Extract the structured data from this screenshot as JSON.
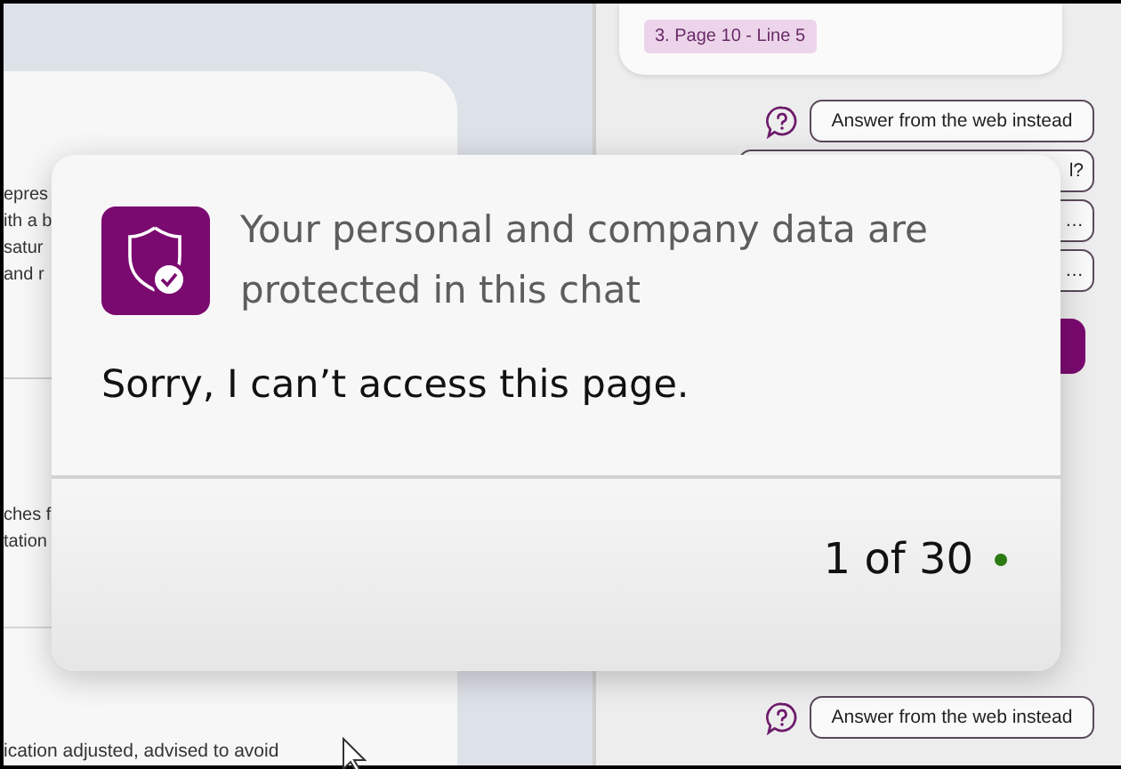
{
  "document": {
    "fragments_top": [
      "epres",
      "ith a b",
      "satur",
      "and r"
    ],
    "fragments_middle": [
      "ches f",
      "tation"
    ],
    "fragment_bottom": "ication adjusted, advised to avoid"
  },
  "chat": {
    "reference_chip": "3. Page 10 - Line 5",
    "suggestions": [
      {
        "label": "Answer from the web instead",
        "help_icon": true
      },
      {
        "label": "l?",
        "help_icon": false
      },
      {
        "label": "…",
        "help_icon": false
      },
      {
        "label": "…",
        "help_icon": false
      }
    ],
    "bottom_suggestion": {
      "label": "Answer from the web instead",
      "help_icon": true
    }
  },
  "popup": {
    "notice": "Your personal and company data are protected in this chat",
    "message": "Sorry, I can’t access this page.",
    "counter": "1 of 30"
  }
}
